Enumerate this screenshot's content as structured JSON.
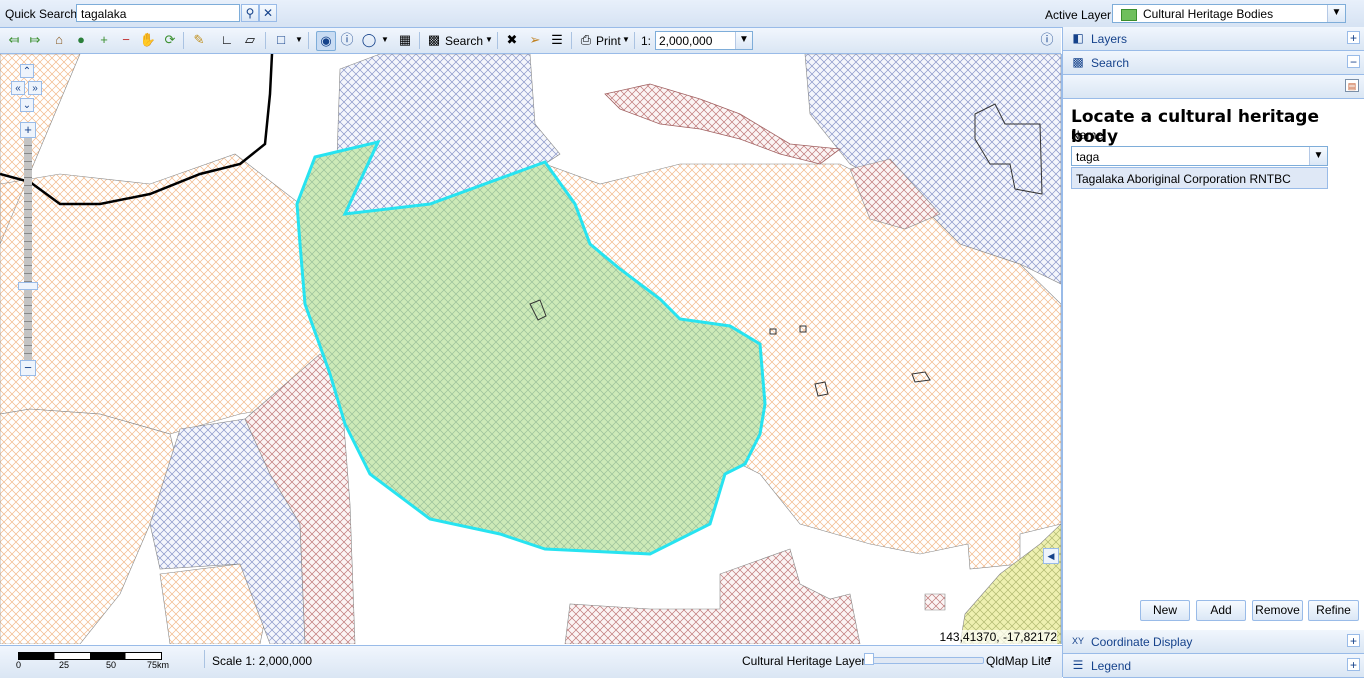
{
  "quick_search": {
    "label": "Quick Search:",
    "value": "tagalaka",
    "search_icon": "magnifier-icon",
    "clear_icon": "close-icon"
  },
  "active_layer": {
    "label": "Active Layer:",
    "value": "Cultural Heritage Bodies"
  },
  "toolbar": {
    "search_label": "Search",
    "print_label": "Print",
    "scale_prefix": "1:",
    "scale_value": "2,000,000"
  },
  "map": {
    "coordinates": "143,41370, -17,82172"
  },
  "statusbar": {
    "scale_ticks": [
      "0",
      "25",
      "50",
      "75km"
    ],
    "scale_text": "Scale 1: 2,000,000",
    "layer_slider_label": "Cultural Heritage Layers",
    "basemap_label": "QldMap Lite"
  },
  "panel": {
    "layers_label": "Layers",
    "search_label": "Search",
    "heading": "Locate a cultural heritage body",
    "name_label": "Name:",
    "name_value": "taga",
    "suggestion": "Tagalaka Aboriginal Corporation RNTBC",
    "buttons": {
      "new": "New",
      "add": "Add",
      "remove": "Remove",
      "refine": "Refine"
    },
    "coordinate_display_label": "Coordinate Display",
    "legend_label": "Legend"
  },
  "colors": {
    "accent": "#15428b",
    "selected_fill": "#c8e6b0",
    "selection_outline": "#1fe0f0",
    "hatch_orange": "#f0b070",
    "hatch_blue": "#8090c8",
    "hatch_red": "#c06060"
  }
}
